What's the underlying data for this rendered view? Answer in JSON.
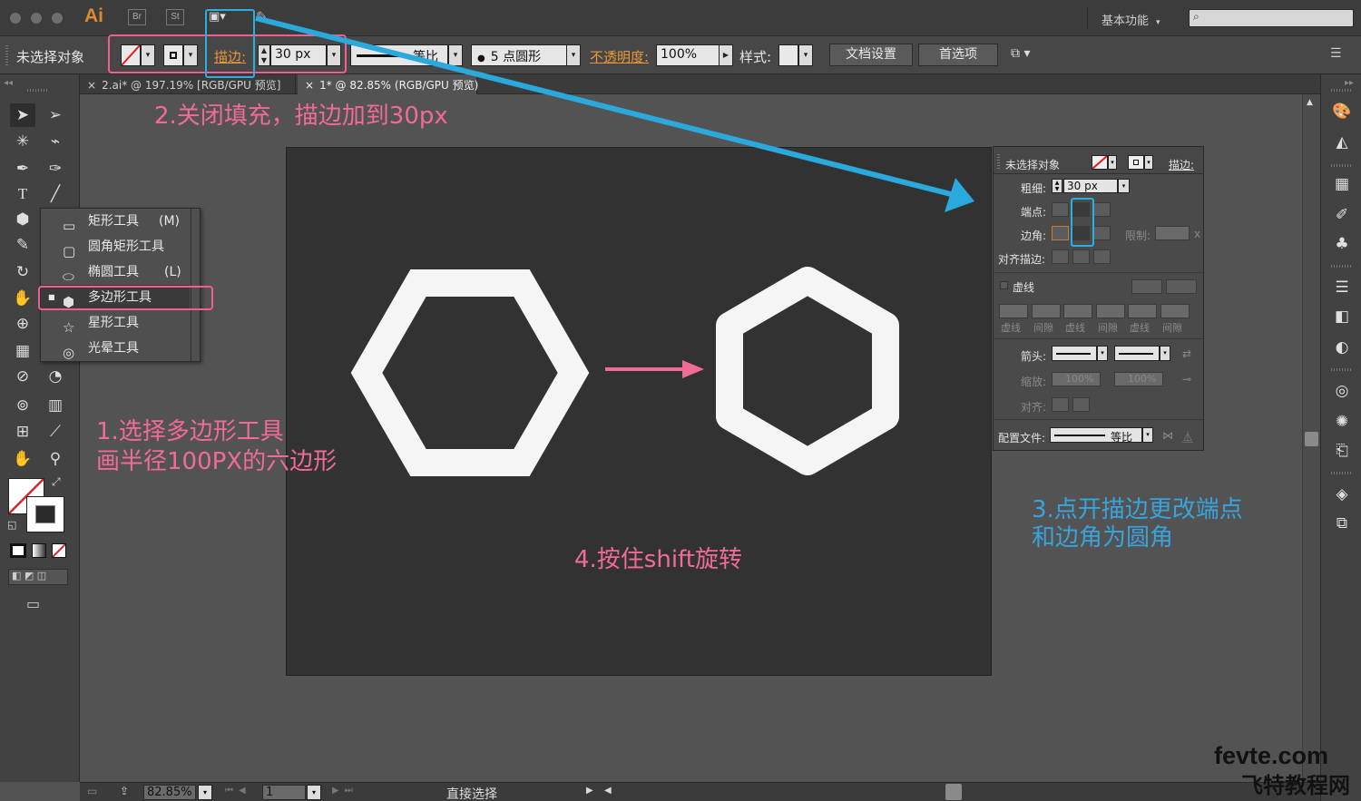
{
  "colors": {
    "accent_orange": "#e9973a",
    "annotation_pink": "#f06b96",
    "annotation_blue": "#37a4dd",
    "hexagon_fill": "#f5f5f5",
    "artboard_bg": "#323232"
  },
  "titlebar": {
    "app_logo": "Ai",
    "br_label": "Br",
    "st_label": "St",
    "workspace_label": "基本功能"
  },
  "controlbar": {
    "selection_status": "未选择对象",
    "stroke_label": "描边:",
    "stroke_weight": "30 px",
    "profile_label": "等比",
    "brush_label": "5 点圆形",
    "opacity_label": "不透明度:",
    "opacity_value": "100%",
    "style_label": "样式:",
    "doc_setup_button": "文档设置",
    "preferences_button": "首选项"
  },
  "tabs": [
    {
      "label": "2.ai* @ 197.19% [RGB/GPU 预览]"
    },
    {
      "label": "1* @ 82.85% (RGB/GPU 预览)"
    }
  ],
  "flyout": {
    "items": [
      {
        "label": "矩形工具",
        "shortcut": "(M)",
        "icon": "rectangle-icon"
      },
      {
        "label": "圆角矩形工具",
        "shortcut": "",
        "icon": "rounded-rectangle-icon"
      },
      {
        "label": "椭圆工具",
        "shortcut": "(L)",
        "icon": "ellipse-icon"
      },
      {
        "label": "多边形工具",
        "shortcut": "",
        "icon": "polygon-icon"
      },
      {
        "label": "星形工具",
        "shortcut": "",
        "icon": "star-icon"
      },
      {
        "label": "光晕工具",
        "shortcut": "",
        "icon": "flare-icon"
      }
    ]
  },
  "stroke_panel": {
    "header_status": "未选择对象",
    "header_stroke_label": "描边:",
    "weight_label": "粗细:",
    "weight_value": "30 px",
    "cap_label": "端点:",
    "corner_label": "边角:",
    "limit_label": "限制:",
    "limit_unit": "x",
    "align_label": "对齐描边:",
    "dashed_label": "虚线",
    "dash_gap_labels": [
      "虚线",
      "间隙",
      "虚线",
      "间隙",
      "虚线",
      "间隙"
    ],
    "arrow_label": "箭头:",
    "scale_label": "缩放:",
    "scale_values": [
      "100%",
      "100%"
    ],
    "align_arrow_label": "对齐:",
    "profile_label": "配置文件:",
    "profile_value": "等比"
  },
  "annotations": {
    "step1_line1": "1.选择多边形工具",
    "step1_line2": "画半径100PX的六边形",
    "step2": "2.关闭填充，描边加到30px",
    "step3_line1": "3.点开描边更改端点",
    "step3_line2": "和边角为圆角",
    "step4": "4.按住shift旋转"
  },
  "statusbar": {
    "zoom": "82.85%",
    "artboard_number": "1",
    "tool_name": "直接选择"
  },
  "watermark": {
    "line1": "fevte.com",
    "line2": "飞特教程网"
  }
}
